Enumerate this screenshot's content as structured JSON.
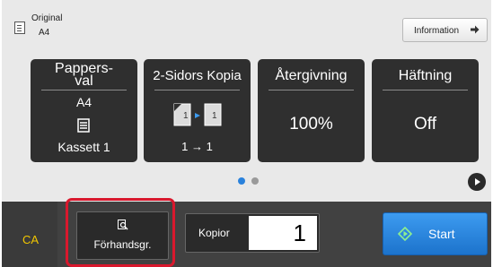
{
  "header": {
    "original_label": "Original",
    "original_size": "A4",
    "info_button": "Information"
  },
  "tiles": [
    {
      "title_line1": "Pappers-",
      "title_line2": "val",
      "value": "A4",
      "sub": "Kassett 1"
    },
    {
      "title": "2-Sidors Kopia",
      "icon_left": "1",
      "icon_right": "1",
      "value": "1 → 1"
    },
    {
      "title": "Återgivning",
      "value": "100%"
    },
    {
      "title": "Häftning",
      "value": "Off"
    }
  ],
  "pager": {
    "total": 2,
    "current": 1
  },
  "bottom": {
    "ca_label": "CA",
    "preview_label": "Förhandsgr.",
    "copies_label": "Kopior",
    "copies_value": "1",
    "start_label": "Start"
  },
  "colors": {
    "accent_blue": "#2a82dc",
    "ca_yellow": "#f2c600",
    "highlight_red": "#d9182d",
    "tile_bg": "#2f2f2f"
  },
  "icons": [
    "original-doc-icon",
    "arrow-right-icon",
    "paper-tray-icon",
    "duplex-copy-icon",
    "preview-magnifier-icon",
    "next-page-icon",
    "start-diamond-icon"
  ]
}
